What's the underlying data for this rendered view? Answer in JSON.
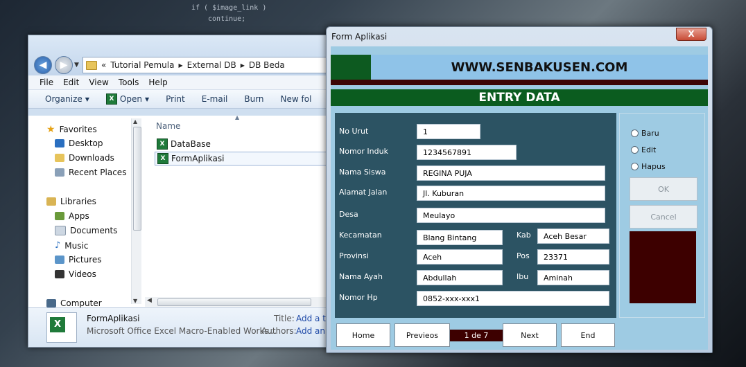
{
  "background_code": [
    "if ( $image_link )",
    "continue;"
  ],
  "explorer": {
    "breadcrumb": [
      "«",
      "Tutorial Pemula",
      "External DB",
      "DB Beda"
    ],
    "menu": [
      "File",
      "Edit",
      "View",
      "Tools",
      "Help"
    ],
    "toolbar": [
      "Organize",
      "Open",
      "Print",
      "E-mail",
      "Burn",
      "New fol"
    ],
    "nav": {
      "favorites": "Favorites",
      "favorites_items": [
        "Desktop",
        "Downloads",
        "Recent Places"
      ],
      "libraries": "Libraries",
      "libraries_items": [
        "Apps",
        "Documents",
        "Music",
        "Pictures",
        "Videos"
      ],
      "computer": "Computer"
    },
    "column_header": "Name",
    "files": [
      "DataBase",
      "FormAplikasi"
    ],
    "details": {
      "name": "FormAplikasi",
      "type": "Microsoft Office Excel Macro-Enabled Works...",
      "title_label": "Title:",
      "title_value": "Add a ti",
      "authors_label": "Authors:",
      "authors_value": "Add an"
    }
  },
  "form": {
    "window_title": "Form Aplikasi",
    "close_label": "X",
    "website": "WWW.SENBAKUSEN.COM",
    "header": "ENTRY DATA",
    "fields": {
      "no_urut": {
        "label": "No Urut",
        "value": "1"
      },
      "nomor_induk": {
        "label": "Nomor Induk",
        "value": "1234567891"
      },
      "nama_siswa": {
        "label": "Nama Siswa",
        "value": "REGINA PUJA"
      },
      "alamat_jalan": {
        "label": "Alamat Jalan",
        "value": "Jl. Kuburan"
      },
      "desa": {
        "label": "Desa",
        "value": "Meulayo"
      },
      "kecamatan": {
        "label": "Kecamatan",
        "value": "Blang Bintang"
      },
      "kab": {
        "label": "Kab",
        "value": "Aceh Besar"
      },
      "provinsi": {
        "label": "Provinsi",
        "value": "Aceh"
      },
      "pos": {
        "label": "Pos",
        "value": "23371"
      },
      "nama_ayah": {
        "label": "Nama Ayah",
        "value": "Abdullah"
      },
      "ibu": {
        "label": "Ibu",
        "value": "Aminah"
      },
      "nomor_hp": {
        "label": "Nomor Hp",
        "value": "0852-xxx-xxx1"
      }
    },
    "options": [
      "Baru",
      "Edit",
      "Hapus"
    ],
    "ok_label": "OK",
    "cancel_label": "Cancel",
    "nav_buttons": {
      "home": "Home",
      "prev": "Previeos",
      "next": "Next",
      "end": "End"
    },
    "page_indicator": "1 de 7"
  }
}
